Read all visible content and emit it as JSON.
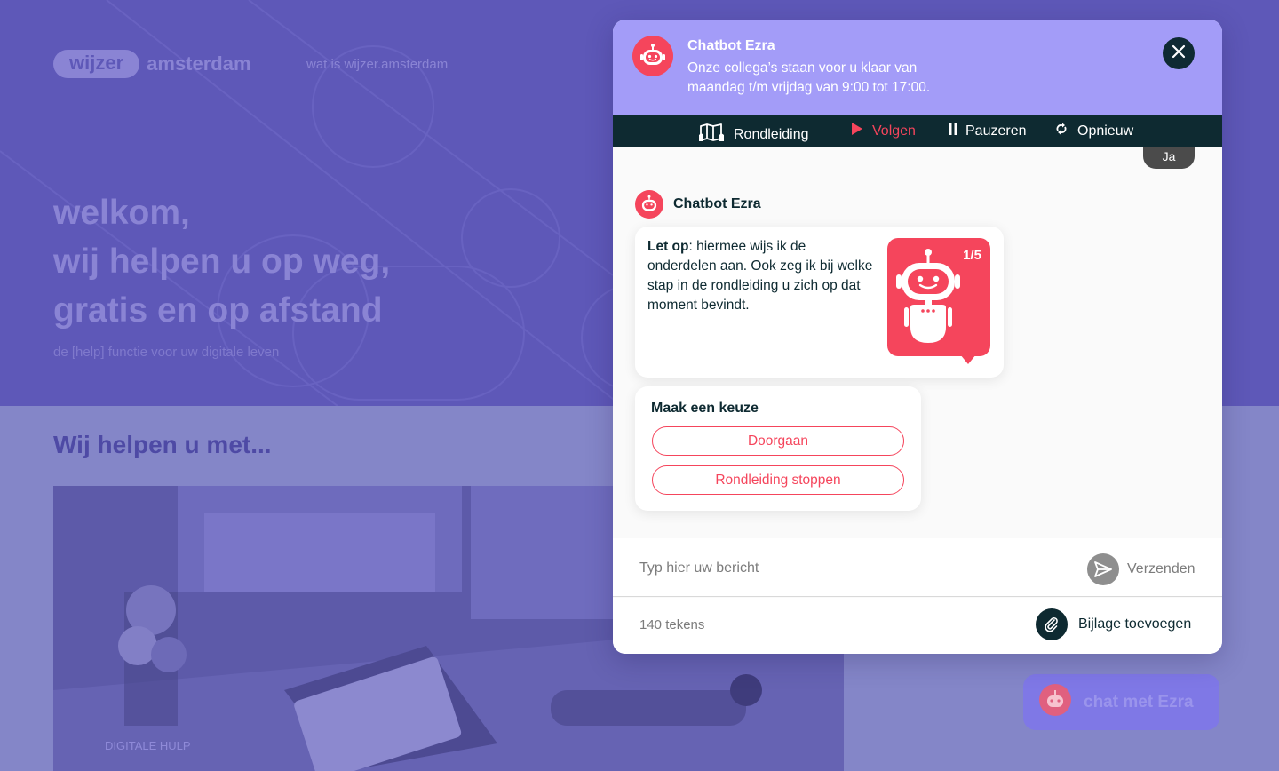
{
  "site": {
    "logo_pill": "wijzer",
    "logo_text": "amsterdam",
    "nav_link": "wat is wijzer.amsterdam",
    "hero_line1": "welkom,",
    "hero_line2": "wij helpen u op weg,",
    "hero_line3": "gratis en op afstand",
    "hero_sub": "de [help] functie voor uw digitale leven",
    "section_title": "Wij helpen u met...",
    "photo_caption": "DIGITALE HULP",
    "chat_fab_label": "chat met Ezra"
  },
  "chat": {
    "header": {
      "name": "Chatbot Ezra",
      "subtitle": "Onze collega’s staan voor u klaar van maandag t/m vrijdag van 9:00 tot 17:00."
    },
    "toolbar": {
      "tour": "Rondleiding",
      "follow": "Volgen",
      "pause": "Pauzeren",
      "restart": "Opnieuw"
    },
    "user_reply": "Ja",
    "bot_name": "Chatbot Ezra",
    "message": {
      "bold": "Let op",
      "text": ": hiermee wijs ik de onderdelen aan. Ook zeg ik bij welke stap in de rondleiding u zich op dat moment bevindt."
    },
    "step": {
      "current": "1",
      "total": "/5"
    },
    "choice": {
      "title": "Maak een keuze",
      "options": [
        "Doorgaan",
        "Rondleiding stoppen"
      ]
    },
    "input": {
      "placeholder": "Typ hier uw bericht",
      "send_label": "Verzenden"
    },
    "footer": {
      "char_count": "140 tekens",
      "attach_label": "Bijlage toevoegen"
    }
  },
  "colors": {
    "accent": "#f5455c",
    "dark": "#0e2a31",
    "header": "#a39cf8",
    "hero_bg": "#5e58b8"
  },
  "icons": {
    "header_avatar": "robot-icon",
    "close": "close-icon",
    "tour": "map-icon",
    "follow": "play-icon",
    "pause": "pause-icon",
    "restart": "refresh-icon",
    "send": "send-icon",
    "attach": "paperclip-icon"
  }
}
